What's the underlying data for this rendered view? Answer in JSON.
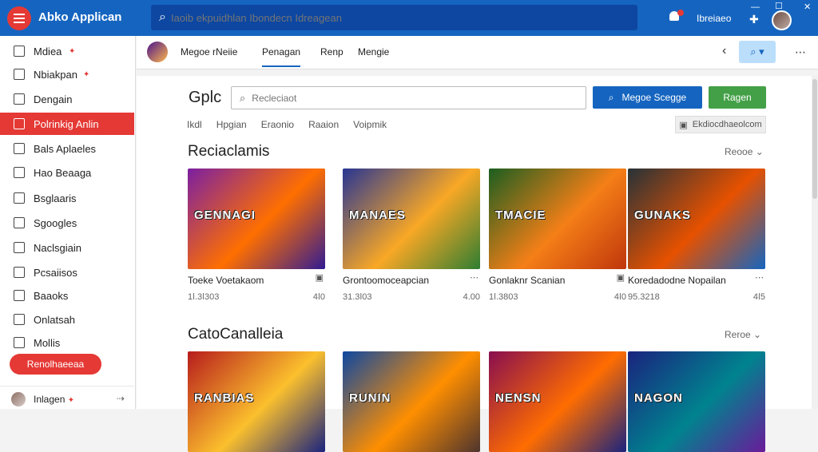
{
  "app": {
    "title": "Abko Applican"
  },
  "topbar": {
    "search_placeholder": "Iaoib ekpuidhlan Ibondecn Idreagean",
    "user_label": "Ibreiaeo",
    "min": "—",
    "max": "☐",
    "close": "✕"
  },
  "sidebar": {
    "items": [
      {
        "label": "Mdiea",
        "star": "✦"
      },
      {
        "label": "Nbiakpan",
        "star": "✦"
      },
      {
        "label": "Dengain"
      },
      {
        "label": "Polrinkig Anlin",
        "active": true
      },
      {
        "label": "Bals Aplaeles"
      },
      {
        "label": "Hao Beaaga"
      },
      {
        "label": "Bsglaaris"
      },
      {
        "label": "Sgoogles"
      },
      {
        "label": "Naclsgiain"
      },
      {
        "label": "Pcsaiisos"
      },
      {
        "label": "Baaoks"
      },
      {
        "label": "Onlatsah"
      },
      {
        "label": "Mollis"
      }
    ],
    "pill": "Renolhaeeaa",
    "bottom_user": "Inlagen",
    "bottom_star": "✦",
    "bottom_arrow": "⇢"
  },
  "subbar": {
    "tabs": [
      "Megoe rNeiie",
      "Penagan",
      "Renp",
      "Mengie"
    ],
    "active_tab": 1
  },
  "main": {
    "title": "Gplc",
    "search_placeholder": "Recleciaot",
    "primary_button": "Megoe Scegge",
    "secondary_button": "Ragen",
    "filters": [
      "Ikdl",
      "Hpgian",
      "Eraonio",
      "Raaion",
      "Voipmik"
    ],
    "filter_button": "Ekdiocdhaeolcom",
    "rows": [
      {
        "title": "Reciaclamis",
        "more": "Reooe",
        "cards": [
          {
            "name": "Toeke Voetakaom",
            "meta_left": "1ǀ.3ǀ303",
            "meta_right": "4ǀ0",
            "banner": "GENNAGI",
            "colors": [
              "#7b1fa2",
              "#ff6f00",
              "#311b92"
            ]
          },
          {
            "name": "Grontoomoceapcian",
            "meta_left": "31.3ǀ03",
            "meta_right": "4.00",
            "banner": "MANAES",
            "colors": [
              "#283593",
              "#f9a825",
              "#2e7d32"
            ]
          },
          {
            "name": "Gonlaknr Scanian",
            "meta_left": "1ǀ.3803",
            "meta_right": "4ǀ0",
            "banner": "TMACIE",
            "colors": [
              "#1b5e20",
              "#f57f17",
              "#bf360c"
            ]
          },
          {
            "name": "Koredadodne Nopailan",
            "meta_left": "95.3218",
            "meta_right": "4ǀ5",
            "banner": "GUNAKS",
            "colors": [
              "#263238",
              "#e65100",
              "#1565c0"
            ]
          }
        ]
      },
      {
        "title": "CatoCanalleia",
        "more": "Reroe",
        "cards": [
          {
            "name": "",
            "banner": "RANBIAS",
            "colors": [
              "#b71c1c",
              "#fbc02d",
              "#1a237e"
            ]
          },
          {
            "name": "",
            "banner": "RUNIN",
            "colors": [
              "#0d47a1",
              "#ff8f00",
              "#4e342e"
            ]
          },
          {
            "name": "",
            "banner": "NENSN",
            "colors": [
              "#880e4f",
              "#ff6d00",
              "#1a237e"
            ]
          },
          {
            "name": "",
            "banner": "NAGON",
            "colors": [
              "#1a237e",
              "#00838f",
              "#6a1b9a"
            ]
          }
        ]
      }
    ]
  }
}
